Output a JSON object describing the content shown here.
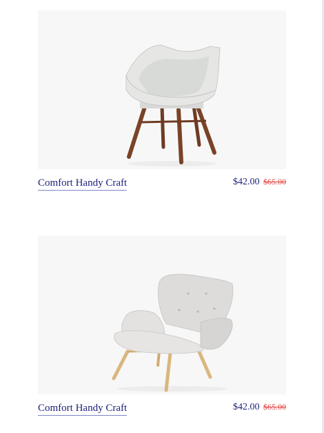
{
  "products": [
    {
      "name": "Comfort Handy Craft",
      "price": "$42.00",
      "old_price": "$65.00",
      "image": "white-shell-chair-walnut-legs"
    },
    {
      "name": "Comfort Handy Craft",
      "price": "$42.00",
      "old_price": "$65.00",
      "image": "grey-wingback-lounge-chair-oak-legs"
    }
  ],
  "colors": {
    "title": "#1c1f7a",
    "old_price": "#e23b3b",
    "image_bg": "#f7f7f7"
  }
}
